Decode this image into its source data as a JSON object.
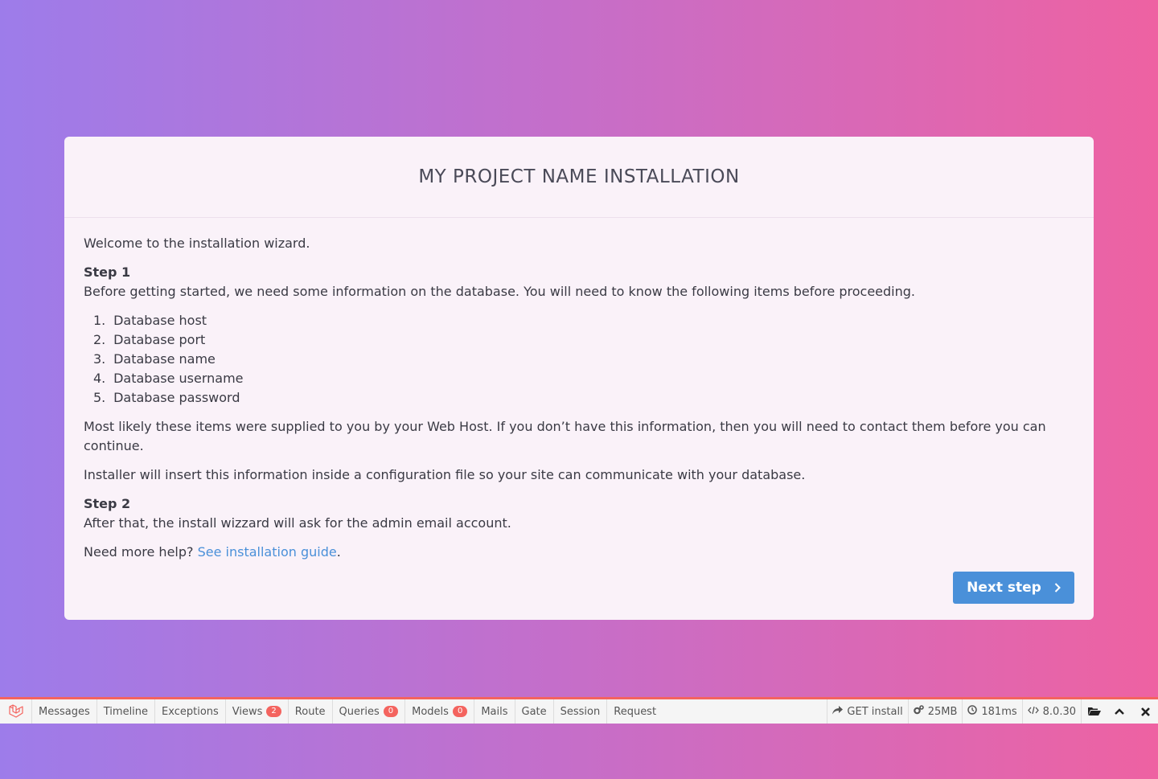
{
  "card": {
    "title": "MY PROJECT NAME INSTALLATION",
    "welcome": "Welcome to the installation wizard.",
    "step1_title": "Step 1",
    "step1_text": "Before getting started, we need some information on the database. You will need to know the following items before proceeding.",
    "items": [
      {
        "num": "1.",
        "label": "Database host"
      },
      {
        "num": "2.",
        "label": "Database port"
      },
      {
        "num": "3.",
        "label": "Database name"
      },
      {
        "num": "4.",
        "label": "Database username"
      },
      {
        "num": "5.",
        "label": "Database password"
      }
    ],
    "supplied_text": "Most likely these items were supplied to you by your Web Host. If you don’t have this information, then you will need to contact them before you can continue.",
    "insert_text": "Installer will insert this information inside a configuration file so your site can communicate with your database.",
    "step2_title": "Step 2",
    "step2_text": "After that, the install wizzard will ask for the admin email account.",
    "help_prefix": "Need more help? ",
    "help_link": "See installation guide",
    "help_suffix": ".",
    "next_button": "Next step"
  },
  "debugbar": {
    "tabs": [
      {
        "label": "Messages"
      },
      {
        "label": "Timeline"
      },
      {
        "label": "Exceptions"
      },
      {
        "label": "Views",
        "badge": "2"
      },
      {
        "label": "Route"
      },
      {
        "label": "Queries",
        "badge": "0"
      },
      {
        "label": "Models",
        "badge": "0"
      },
      {
        "label": "Mails"
      },
      {
        "label": "Gate"
      },
      {
        "label": "Session"
      },
      {
        "label": "Request"
      }
    ],
    "request": "GET install",
    "memory": "25MB",
    "time": "181ms",
    "php_version": "8.0.30",
    "icons": {
      "logo": "laravel-logo-icon",
      "request": "share-arrow-icon",
      "memory": "cogs-icon",
      "time": "clock-icon",
      "version": "code-icon",
      "open": "folder-open-icon",
      "restore": "chevron-up-icon",
      "close": "close-icon"
    },
    "accent_color": "#f4645f"
  },
  "colors": {
    "button": "#4a90d9",
    "link": "#4a90d9",
    "card_bg": "#faf2f9"
  }
}
